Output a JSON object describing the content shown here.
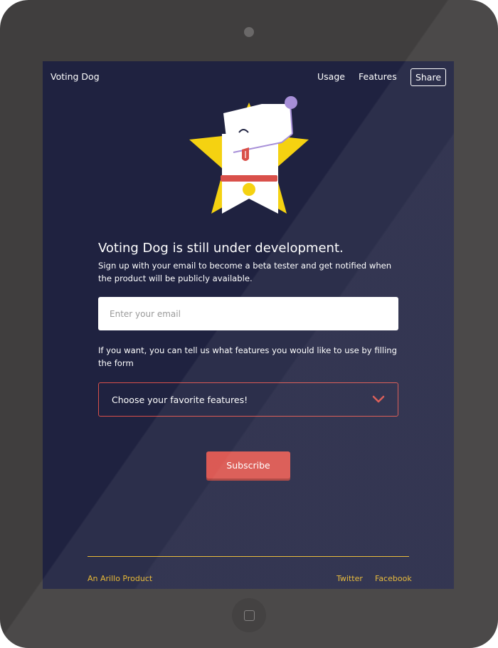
{
  "device": {
    "frame_color": "#403e3e",
    "camera_icon": "camera-dot",
    "home_button_icon": "rounded-square"
  },
  "nav": {
    "brand": "Voting Dog",
    "links": [
      "Usage",
      "Features"
    ],
    "share_label": "Share"
  },
  "hero": {
    "mascot_icon": "dog-star-mascot",
    "headline": "Voting Dog is still under development.",
    "subtext": "Sign up with your email to become a beta tester and get notified when the product will be publicly available."
  },
  "form": {
    "email_placeholder": "Enter your email",
    "email_value": "",
    "features_hint": "If you want, you can tell us what features you would like to use by filling the form",
    "features_select_label": "Choose your favorite features!",
    "features_select_icon": "chevron-down-icon",
    "subscribe_label": "Subscribe"
  },
  "footer": {
    "credit": "An Arillo Product",
    "links": [
      "Twitter",
      "Facebook"
    ]
  },
  "colors": {
    "screen_bg": "#1f2240",
    "accent_red": "#d9504a",
    "accent_yellow": "#e7b52a",
    "text": "#ffffff"
  }
}
